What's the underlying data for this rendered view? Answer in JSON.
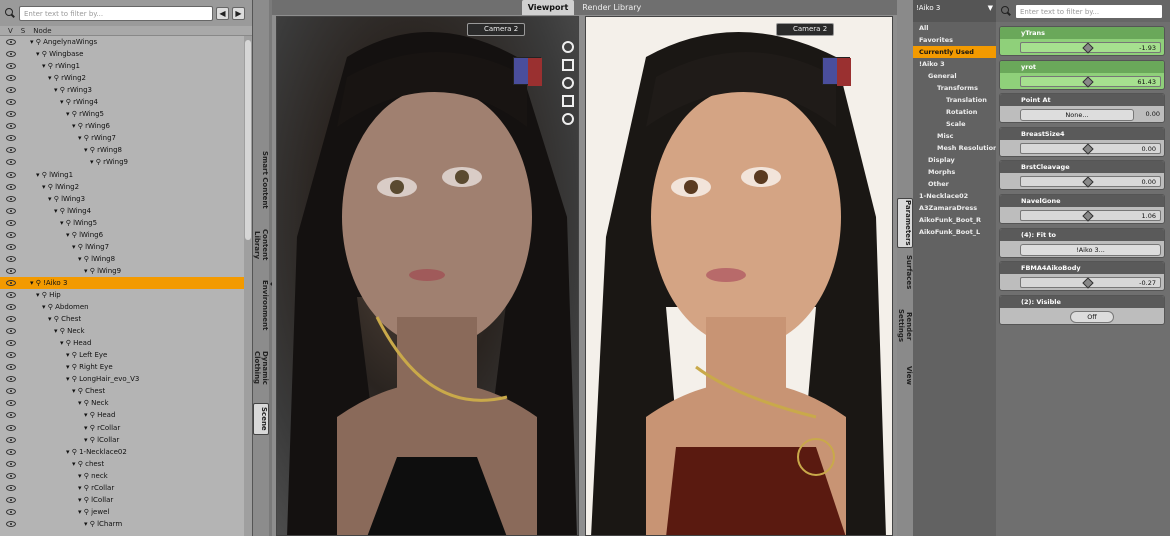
{
  "scene": {
    "filter_placeholder": "Enter text to filter by...",
    "col_v": "V",
    "col_s": "S",
    "col_node": "Node",
    "rows": [
      [
        "AngelynaWings",
        0
      ],
      [
        "Wingbase",
        1
      ],
      [
        "rWing1",
        2
      ],
      [
        "rWing2",
        3
      ],
      [
        "rWing3",
        4
      ],
      [
        "rWing4",
        5
      ],
      [
        "rWing5",
        6
      ],
      [
        "rWing6",
        7
      ],
      [
        "rWing7",
        8
      ],
      [
        "rWing8",
        9
      ],
      [
        "rWing9",
        10
      ],
      [
        "lWing1",
        1
      ],
      [
        "lWing2",
        2
      ],
      [
        "lWing3",
        3
      ],
      [
        "lWing4",
        4
      ],
      [
        "lWing5",
        5
      ],
      [
        "lWing6",
        6
      ],
      [
        "lWing7",
        7
      ],
      [
        "lWing8",
        8
      ],
      [
        "lWing9",
        9
      ],
      [
        "!Aiko 3",
        0
      ],
      [
        "Hip",
        1
      ],
      [
        "Abdomen",
        2
      ],
      [
        "Chest",
        3
      ],
      [
        "Neck",
        4
      ],
      [
        "Head",
        5
      ],
      [
        "Left Eye",
        6
      ],
      [
        "Right Eye",
        6
      ],
      [
        "LongHair_evo_V3",
        6
      ],
      [
        "Chest",
        7
      ],
      [
        "Neck",
        8
      ],
      [
        "Head",
        9
      ],
      [
        "rCollar",
        9
      ],
      [
        "lCollar",
        9
      ],
      [
        "1-Necklace02",
        6
      ],
      [
        "chest",
        7
      ],
      [
        "neck",
        8
      ],
      [
        "rCollar",
        8
      ],
      [
        "lCollar",
        8
      ],
      [
        "jewel",
        8
      ],
      [
        "lCharm",
        9
      ]
    ],
    "selected_index": 20
  },
  "vtabs_left": [
    "Smart Content",
    "Content Library",
    "Environment",
    "Dynamic Clothing",
    "Scene"
  ],
  "viewport": {
    "tabs": [
      "Viewport",
      "Render Library"
    ],
    "camera_left": "Camera 2",
    "camera_right": "Camera 2"
  },
  "vtabs_right": [
    "Parameters",
    "Surfaces",
    "Render Settings",
    "View"
  ],
  "paramtree": {
    "figure": "!Aiko 3",
    "items": [
      [
        "All",
        0,
        false
      ],
      [
        "Favorites",
        0,
        false
      ],
      [
        "Currently Used",
        0,
        true
      ],
      [
        "!Aiko 3",
        0,
        false
      ],
      [
        "General",
        1,
        false
      ],
      [
        "Transforms",
        2,
        false
      ],
      [
        "Translation",
        3,
        false
      ],
      [
        "Rotation",
        3,
        false
      ],
      [
        "Scale",
        3,
        false
      ],
      [
        "Misc",
        2,
        false
      ],
      [
        "Mesh Resolution",
        2,
        false
      ],
      [
        "Display",
        1,
        false
      ],
      [
        "Morphs",
        1,
        false
      ],
      [
        "Other",
        1,
        false
      ],
      [
        "1-Necklace02",
        0,
        false
      ],
      [
        "A3ZamaraDress",
        0,
        false
      ],
      [
        "AikoFunk_Boot_R",
        0,
        false
      ],
      [
        "AikoFunk_Boot_L",
        0,
        false
      ]
    ]
  },
  "params": {
    "filter_placeholder": "Enter text to filter by...",
    "cards": [
      {
        "title": "yTrans",
        "value": "-1.93",
        "kind": "slider",
        "green": true,
        "pos": 0.45
      },
      {
        "title": "yrot",
        "value": "61.43",
        "kind": "slider",
        "green": true,
        "pos": 0.45
      },
      {
        "title": "Point At",
        "value": "0.00",
        "kind": "button",
        "label": "None..."
      },
      {
        "title": "BreastSize4",
        "value": "0.00",
        "kind": "slider",
        "pos": 0.45
      },
      {
        "title": "BrstCleavage",
        "value": "0.00",
        "kind": "slider",
        "pos": 0.45
      },
      {
        "title": "NavelGone",
        "value": "1.06",
        "kind": "slider",
        "pos": 0.45
      },
      {
        "title": "(4): Fit to",
        "value": "",
        "kind": "button",
        "label": "!Aiko 3..."
      },
      {
        "title": "FBMA4AikoBody",
        "value": "-0.27",
        "kind": "slider",
        "pos": 0.45
      },
      {
        "title": "(2): Visible",
        "value": "",
        "kind": "toggle",
        "label": "Off"
      }
    ]
  },
  "colors": {
    "accent": "#f39a00",
    "green": "#8fd07a"
  }
}
